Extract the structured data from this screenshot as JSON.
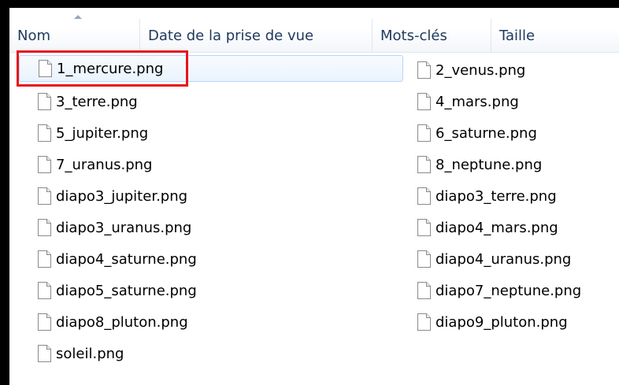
{
  "columns": [
    {
      "label": "Nom"
    },
    {
      "label": "Date de la prise de vue"
    },
    {
      "label": "Mots-clés"
    },
    {
      "label": "Taille"
    }
  ],
  "files_left": [
    {
      "name": "1_mercure.png",
      "selected": true
    },
    {
      "name": "3_terre.png"
    },
    {
      "name": "5_jupiter.png"
    },
    {
      "name": "7_uranus.png"
    },
    {
      "name": "diapo3_jupiter.png"
    },
    {
      "name": "diapo3_uranus.png"
    },
    {
      "name": "diapo4_saturne.png"
    },
    {
      "name": "diapo5_saturne.png"
    },
    {
      "name": "diapo8_pluton.png"
    },
    {
      "name": "soleil.png"
    }
  ],
  "files_right": [
    {
      "name": "2_venus.png"
    },
    {
      "name": "4_mars.png"
    },
    {
      "name": "6_saturne.png"
    },
    {
      "name": "8_neptune.png"
    },
    {
      "name": "diapo3_terre.png"
    },
    {
      "name": "diapo4_mars.png"
    },
    {
      "name": "diapo4_uranus.png"
    },
    {
      "name": "diapo7_neptune.png"
    },
    {
      "name": "diapo9_pluton.png"
    }
  ],
  "colors": {
    "highlight": "#e8141b",
    "selection_border": "#b8d6fb",
    "header_text": "#1e395b"
  },
  "icons": {
    "file": "generic-file-icon",
    "sort": "sort-ascending-icon"
  }
}
